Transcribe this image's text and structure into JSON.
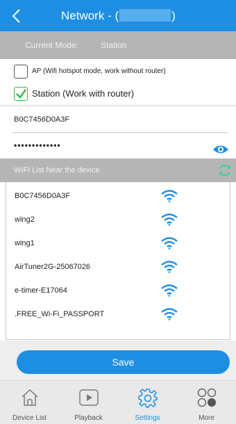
{
  "header": {
    "title_prefix": "Network  - (",
    "title_suffix": ")"
  },
  "mode": {
    "label": "Current Mode:",
    "value": "Station"
  },
  "options": {
    "ap_label": "AP (Wifi hotspot mode, work without router)",
    "ap_checked": false,
    "station_label": "Station (Work with router)",
    "station_checked": true
  },
  "fields": {
    "ssid_value": "B0C7456D0A3F",
    "password_masked": "•••••••••••••"
  },
  "wifi_list": {
    "title": "WIFI List Near the device",
    "networks": [
      "B0C7456D0A3F",
      "wing2",
      "wing1",
      "AirTuner2G-25067026",
      "e-timer-E17064",
      ".FREE_Wi-Fi_PASSPORT"
    ]
  },
  "save_label": "Save",
  "tabs": [
    {
      "label": "Device List",
      "icon": "home-icon"
    },
    {
      "label": "Playback",
      "icon": "play-icon"
    },
    {
      "label": "Settings",
      "icon": "gear-icon",
      "active": true
    },
    {
      "label": "More",
      "icon": "more-icon"
    }
  ],
  "colors": {
    "accent": "#1e8ee3",
    "header_bar": "#b5b5b5",
    "check": "#39b54a",
    "refresh": "#39d2a0"
  }
}
